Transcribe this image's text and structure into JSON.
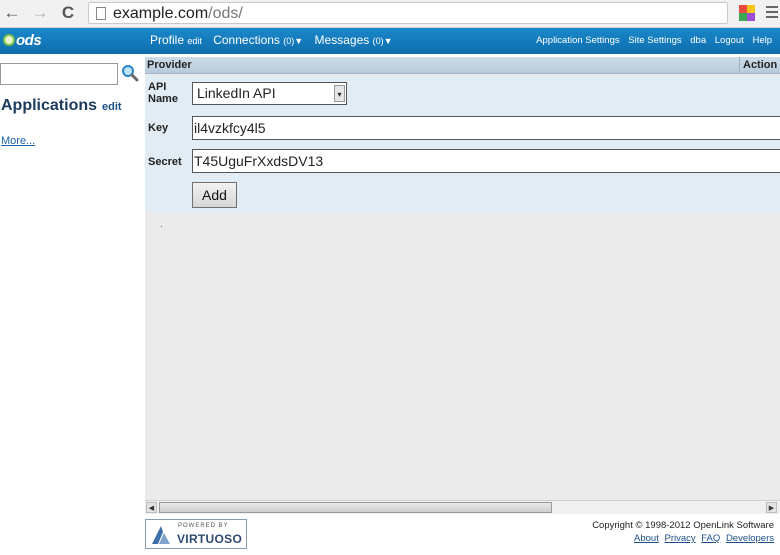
{
  "browser": {
    "back_glyph": "←",
    "forward_glyph": "→",
    "reload_glyph": "C",
    "url_host": "example.com",
    "url_path": "/ods/"
  },
  "appbar": {
    "logo": "ods",
    "nav": {
      "profile": "Profile",
      "profile_edit": "edit",
      "connections": "Connections",
      "connections_count": "(0)",
      "messages": "Messages",
      "messages_count": "(0)",
      "caret": "▼"
    },
    "links": [
      "Application Settings",
      "Site Settings",
      "dba",
      "Logout",
      "Help"
    ]
  },
  "sidebar": {
    "search_value": "",
    "apps_title": "Applications",
    "apps_edit": "edit",
    "more": "More..."
  },
  "table": {
    "col_provider": "Provider",
    "col_action": "Action"
  },
  "form": {
    "api_name_label_1": "API",
    "api_name_label_2": "Name",
    "api_name_value": "LinkedIn API",
    "key_label": "Key",
    "key_value": "il4vzkfcy4l5",
    "secret_label": "Secret",
    "secret_value": "T45UguFrXxdsDV13",
    "add_label": "Add",
    "dot": "."
  },
  "footer": {
    "badge_powered": "POWERED BY",
    "badge_name": "VIRTUOSO",
    "copyright": "Copyright © 1998-2012 OpenLink Software",
    "links": [
      "About",
      "Privacy",
      "FAQ",
      "Developers"
    ]
  }
}
